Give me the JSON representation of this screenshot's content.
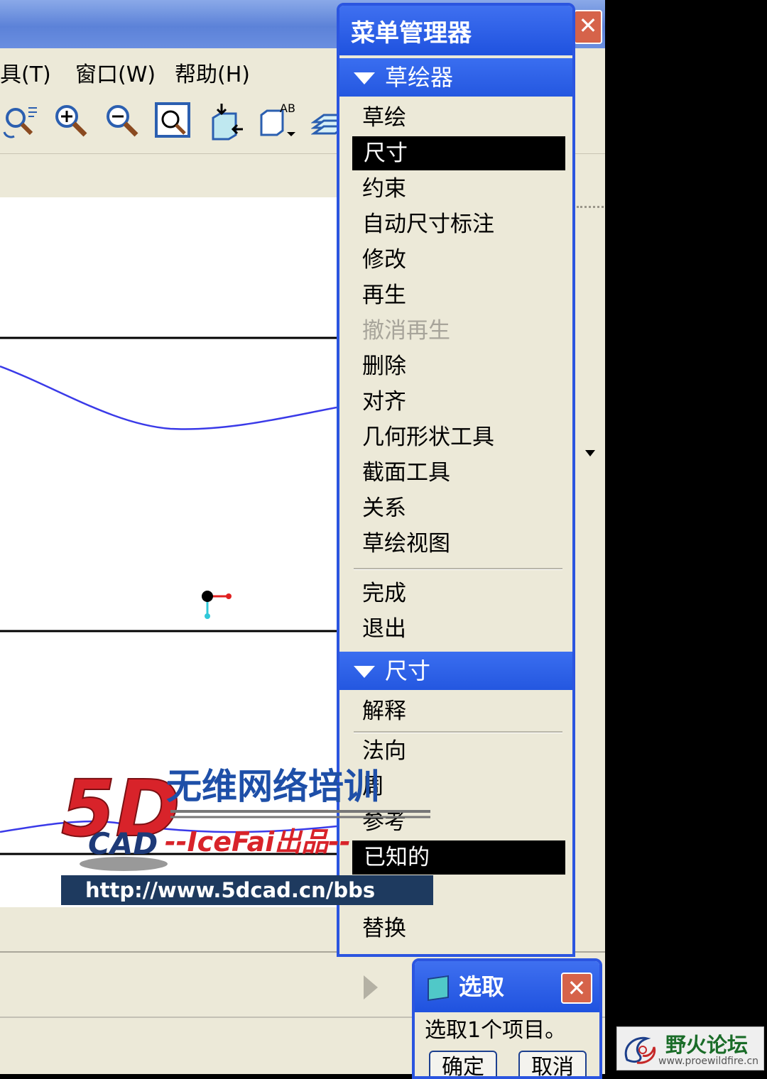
{
  "window": {
    "close_glyph": "✕"
  },
  "menubar": {
    "items": [
      "具(T)",
      "窗口(W)",
      "帮助(H)"
    ]
  },
  "toolbar": {
    "icons": [
      "repaint-icon",
      "zoom-in-icon",
      "zoom-out-icon",
      "refit-icon",
      "orient-icon",
      "named-view-icon",
      "layers-icon"
    ]
  },
  "menu_manager": {
    "title": "菜单管理器",
    "sketcher_section": {
      "label": "草绘器",
      "items": [
        {
          "label": "草绘",
          "state": "normal"
        },
        {
          "label": "尺寸",
          "state": "selected"
        },
        {
          "label": "约束",
          "state": "normal"
        },
        {
          "label": "自动尺寸标注",
          "state": "normal"
        },
        {
          "label": "修改",
          "state": "normal"
        },
        {
          "label": "再生",
          "state": "normal"
        },
        {
          "label": "撤消再生",
          "state": "disabled"
        },
        {
          "label": "删除",
          "state": "normal"
        },
        {
          "label": "对齐",
          "state": "normal"
        },
        {
          "label": "几何形状工具",
          "state": "normal"
        },
        {
          "label": "截面工具",
          "state": "normal"
        },
        {
          "label": "关系",
          "state": "normal"
        },
        {
          "label": "草绘视图",
          "state": "normal"
        }
      ],
      "footer_items": [
        "完成",
        "退出"
      ]
    },
    "dimension_section": {
      "label": "尺寸",
      "items": [
        {
          "label": "解释",
          "state": "normal"
        },
        {
          "label": "法向",
          "state": "normal"
        },
        {
          "label": "周",
          "state": "normal"
        },
        {
          "label": "参考",
          "state": "normal"
        },
        {
          "label": "已知的",
          "state": "selected"
        },
        {
          "label": "",
          "state": "normal"
        },
        {
          "label": "替换",
          "state": "normal"
        }
      ]
    }
  },
  "select_dialog": {
    "title": "选取",
    "message": "选取1个项目。",
    "ok_label": "确定",
    "cancel_label": "取消",
    "close_glyph": "✕"
  },
  "watermark": {
    "brand_mark": "5D",
    "brand_sub": "CAD",
    "slogan": "无维网络培训",
    "author": "--IceFai出品--",
    "url": "http://www.5dcad.cn/bbs"
  },
  "forum_logo": {
    "name": "野火论坛",
    "url": "www.proewildfire.cn"
  },
  "colors": {
    "title_blue": "#2457e0",
    "curve_blue": "#3a3ae8",
    "selected_bg": "#000000",
    "disabled_text": "#a7a49a"
  }
}
